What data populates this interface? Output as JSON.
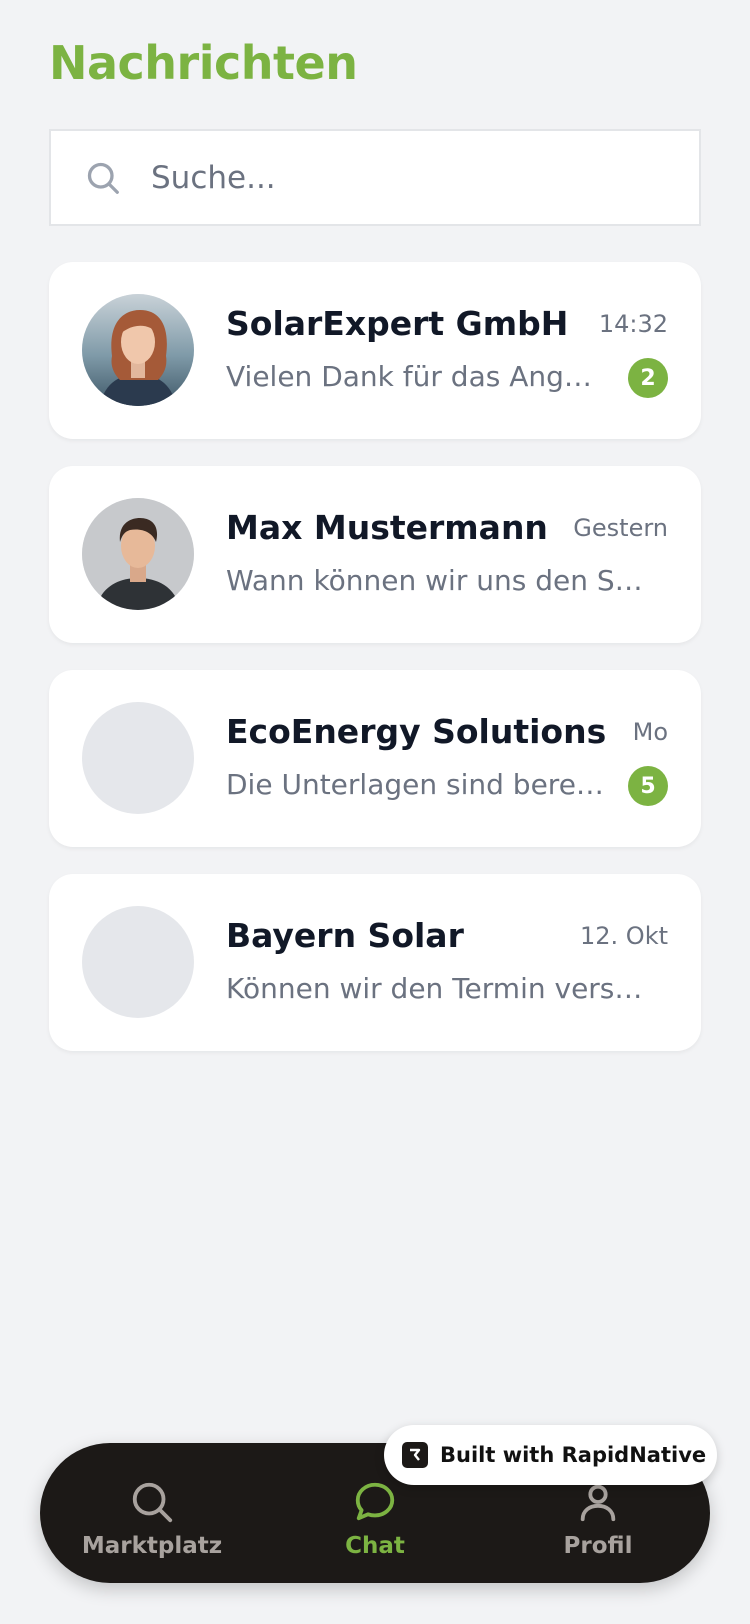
{
  "header": {
    "title": "Nachrichten"
  },
  "search": {
    "placeholder": "Suche..."
  },
  "chats": [
    {
      "name": "SolarExpert GmbH",
      "time": "14:32",
      "preview": "Vielen Dank für das Angebot. Wir melden uns.",
      "unread": "2",
      "avatar": "woman-photo"
    },
    {
      "name": "Max Mustermann",
      "time": "Gestern",
      "preview": "Wann können wir uns den Standort ansehen?",
      "unread": "",
      "avatar": "man-photo"
    },
    {
      "name": "EcoEnergy Solutions",
      "time": "Mo",
      "preview": "Die Unterlagen sind bereit zur Unterschrift.",
      "unread": "5",
      "avatar": "placeholder"
    },
    {
      "name": "Bayern Solar",
      "time": "12. Okt",
      "preview": "Können wir den Termin verschieben?",
      "unread": "",
      "avatar": "placeholder"
    }
  ],
  "tabs": [
    {
      "label": "Marktplatz",
      "icon": "search-icon",
      "active": false
    },
    {
      "label": "Chat",
      "icon": "chat-bubble-icon",
      "active": true
    },
    {
      "label": "Profil",
      "icon": "user-icon",
      "active": false
    }
  ],
  "badge": {
    "text": "Built with RapidNative"
  },
  "colors": {
    "accent": "#7cb342",
    "tabbar": "#1c1917",
    "background": "#f2f3f5"
  }
}
